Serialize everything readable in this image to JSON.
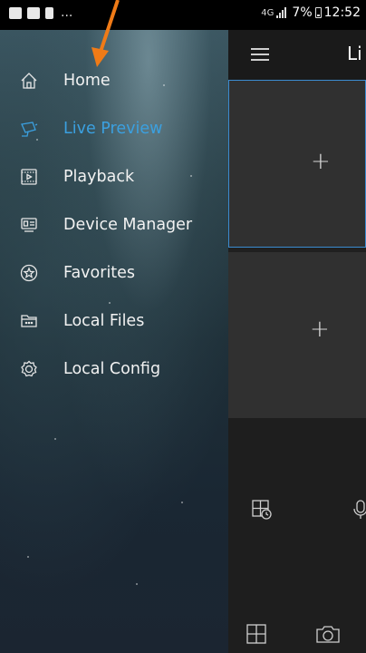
{
  "status_bar": {
    "signal_text": "4G",
    "battery_percent": "7%",
    "time": "12:52",
    "ellipsis": "..."
  },
  "app": {
    "title_partial": "Li",
    "cells": [
      {
        "name": "video-cell-1",
        "icon": "plus-icon",
        "label": "+"
      },
      {
        "name": "video-cell-2",
        "icon": "plus-icon",
        "label": "+"
      }
    ],
    "controls": [
      "grid-clock-icon",
      "microphone-icon",
      "grid-layout-icon",
      "camera-icon"
    ]
  },
  "drawer": {
    "items": [
      {
        "label": "Home",
        "icon": "home-icon",
        "active": false
      },
      {
        "label": "Live Preview",
        "icon": "live-camera-icon",
        "active": true
      },
      {
        "label": "Playback",
        "icon": "playback-icon",
        "active": false
      },
      {
        "label": "Device Manager",
        "icon": "device-manager-icon",
        "active": false
      },
      {
        "label": "Favorites",
        "icon": "favorites-star-icon",
        "active": false
      },
      {
        "label": "Local Files",
        "icon": "local-files-folder-icon",
        "active": false
      },
      {
        "label": "Local Config",
        "icon": "local-config-gear-icon",
        "active": false
      }
    ]
  },
  "colors": {
    "active": "#3ba0e0",
    "text": "#f2f2f2",
    "cell_border": "#3b8bd0",
    "annotation_arrow": "#f07b17"
  }
}
